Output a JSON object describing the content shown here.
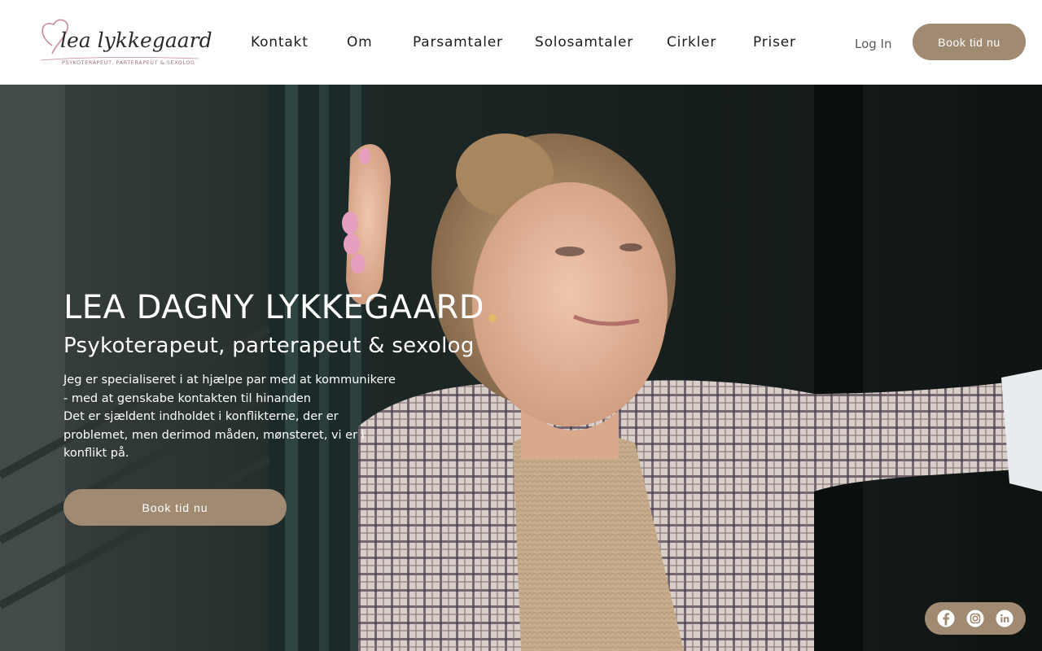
{
  "header": {
    "logo": {
      "script_text": "lea lykkegaard",
      "tagline": "PSYKOTERAPEUT, PARTERAPEUT & SEXOLOG"
    },
    "nav": [
      {
        "label": "Kontakt"
      },
      {
        "label": "Om"
      },
      {
        "label": "Parsamtaler"
      },
      {
        "label": "Solosamtaler"
      },
      {
        "label": "Cirkler"
      },
      {
        "label": "Priser"
      }
    ],
    "login_label": "Log In",
    "book_label": "Book tid nu"
  },
  "hero": {
    "name": "LEA DAGNY LYKKEGAARD",
    "subtitle": "Psykoterapeut, parterapeut & sexolog",
    "body_lines": [
      "Jeg er specialiseret i at hjælpe par med at kommunikere",
      "- med at genskabe kontakten til hinanden",
      "Det er sjældent indholdet i konflikterne, der er",
      "problemet, men derimod måden, mønsteret, vi er i",
      "konflikt på."
    ],
    "button_label": "Book tid nu"
  },
  "social": {
    "icons": [
      "facebook-icon",
      "instagram-icon",
      "linkedin-icon"
    ]
  },
  "colors": {
    "accent": "#a08a72",
    "logo_pink": "#c98a9a",
    "text_dark": "#1c1c1c"
  }
}
